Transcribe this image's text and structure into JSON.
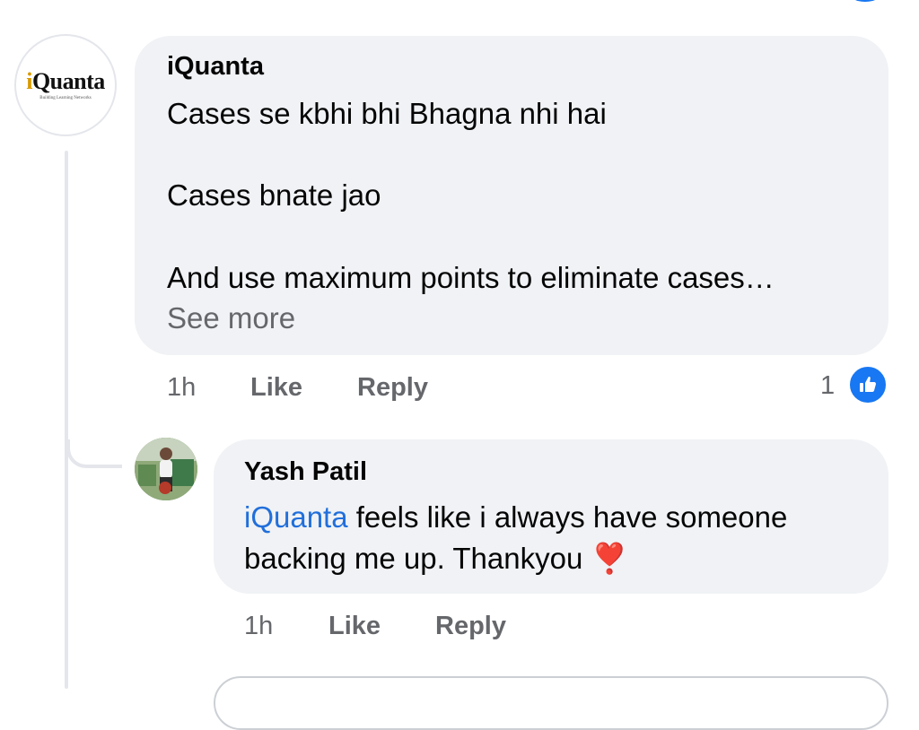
{
  "comment": {
    "author": "iQuanta",
    "logo_text_highlight": "i",
    "logo_text_rest": "Quanta",
    "logo_tagline": "Building Learning Networks",
    "lines": [
      "Cases se kbhi bhi Bhagna nhi hai",
      "Cases bnate jao",
      "And use maximum points to eliminate cases…"
    ],
    "see_more": "See more",
    "time": "1h",
    "like_label": "Like",
    "reply_label": "Reply",
    "reaction_count": "1",
    "reaction_icon": "like-thumb-icon"
  },
  "reply": {
    "author": "Yash Patil",
    "mention": "iQuanta",
    "text_after_mention": " feels like i always have someone",
    "line2": "backing me up. Thankyou ",
    "emoji": "❣️",
    "time": "1h",
    "like_label": "Like",
    "reply_label": "Reply"
  },
  "colors": {
    "bubble": "#f0f2f5",
    "mention": "#216fdb",
    "meta": "#65676b",
    "like_blue": "#1877f2"
  }
}
